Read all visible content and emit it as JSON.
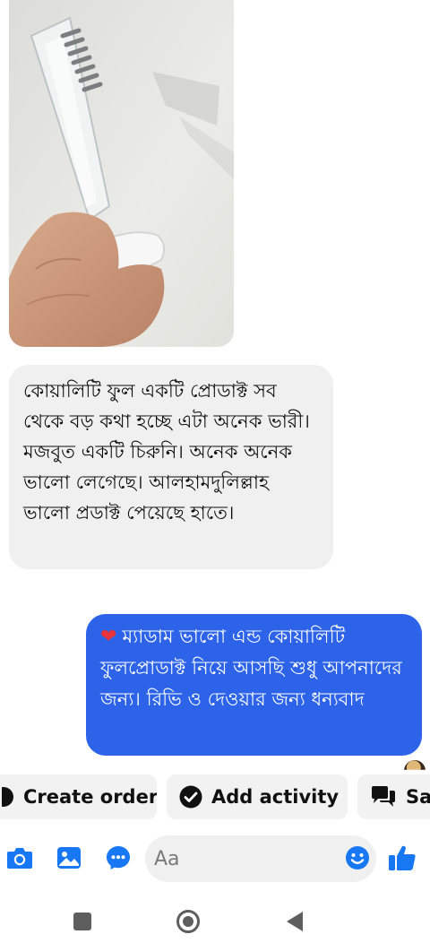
{
  "messages": {
    "incoming_text": "কোয়ালিটি ফুল একটি প্রোডাক্ট সব থেকে বড় কথা হচ্ছে এটা অনেক ভারী। মজবুত একটি চিরুনি। অনেক অনেক ভালো লেগেছে। আলহামদুলিল্লাহ ভালো প্রডাক্ট পেয়েছে হাতে।",
    "outgoing_emoji": "❤",
    "outgoing_text": "ম্যাডাম ভালো এন্ড কোয়ালিটি ফুলপ্রোডাক্ট নিয়ে আসছি শুধু আপনাদের জন্য। রিভি ও দেওয়ার জন্য ধন্যবাদ"
  },
  "actions": {
    "create_order": "Create order",
    "add_activity": "Add activity",
    "save_partial": "Sa"
  },
  "composer": {
    "placeholder": "Aa"
  },
  "colors": {
    "outgoing_bubble": "#2d63e8",
    "incoming_bubble": "#f0f0f0",
    "accent": "#1877f2",
    "heart": "#e8343a"
  },
  "icons": {
    "composer": [
      "camera-icon",
      "gallery-icon",
      "messenger-icon",
      "emoji-icon",
      "thumbs-up-icon"
    ],
    "chips": [
      "order-icon",
      "check-circle-icon",
      "saved-replies-icon"
    ],
    "nav": [
      "recents-icon",
      "home-icon",
      "back-icon"
    ]
  }
}
